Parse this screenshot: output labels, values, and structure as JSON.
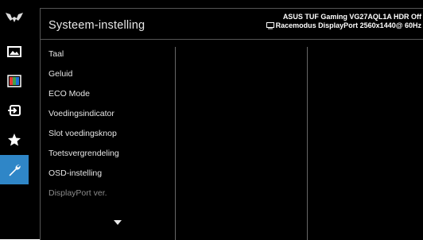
{
  "header": {
    "title": "Systeem-instelling",
    "model_line": "ASUS TUF Gaming  VG27AQL1A HDR Off",
    "mode_line": "Racemodus  DisplayPort  2560x1440@ 60Hz"
  },
  "sidebar": {
    "logo_icon": "tuf-gaming-logo-icon",
    "items": [
      {
        "icon": "image-icon"
      },
      {
        "icon": "color-bars-icon"
      },
      {
        "icon": "input-select-icon"
      },
      {
        "icon": "star-icon"
      },
      {
        "icon": "wrench-icon",
        "active": true
      }
    ]
  },
  "menu": {
    "items": [
      {
        "label": "Taal"
      },
      {
        "label": "Geluid"
      },
      {
        "label": "ECO Mode"
      },
      {
        "label": "Voedingsindicator"
      },
      {
        "label": "Slot voedingsknop"
      },
      {
        "label": "Toetsvergrendeling"
      },
      {
        "label": "OSD-instelling"
      },
      {
        "label": "DisplayPort ver."
      }
    ]
  },
  "colors": {
    "background": "#000000",
    "accent": "#2f86c7",
    "text": "#e6e6e6",
    "dim_text": "#8c8c8c"
  }
}
